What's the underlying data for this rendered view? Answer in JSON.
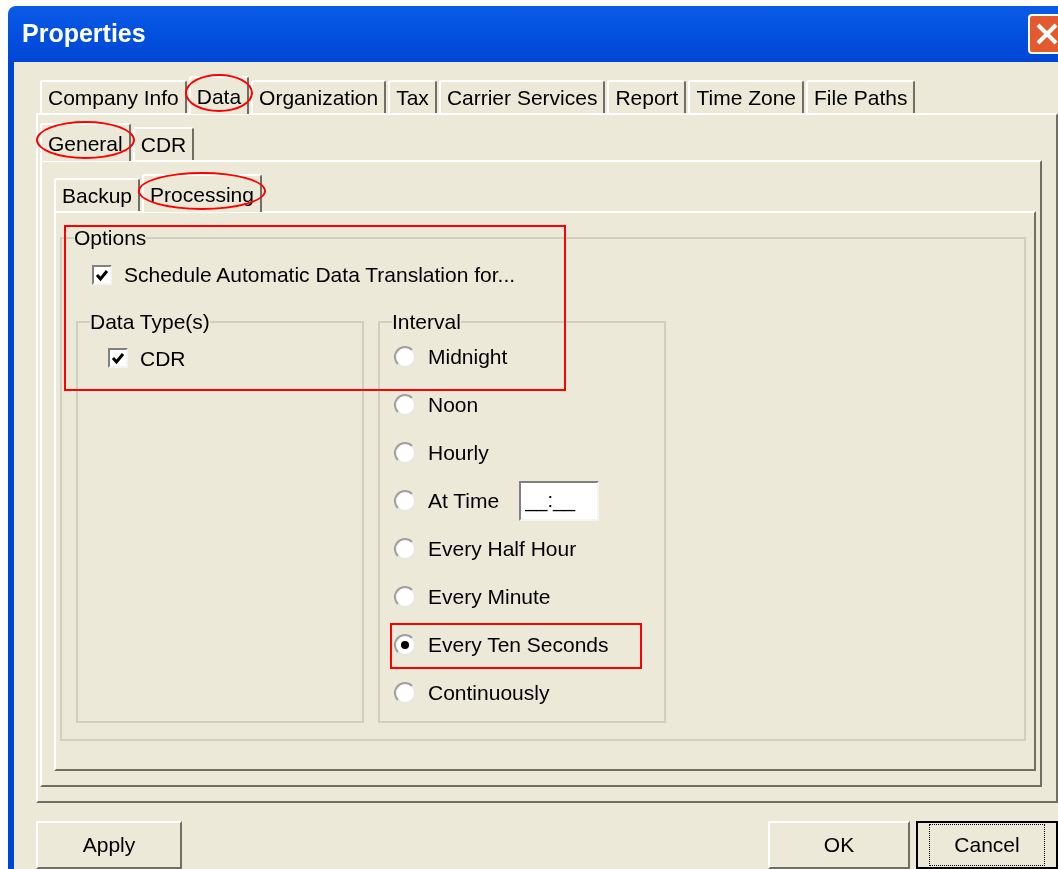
{
  "window": {
    "title": "Properties"
  },
  "tabs": [
    {
      "label": "Company Info",
      "selected": false,
      "circled": false
    },
    {
      "label": "Data",
      "selected": true,
      "circled": true
    },
    {
      "label": "Organization",
      "selected": false,
      "circled": false
    },
    {
      "label": "Tax",
      "selected": false,
      "circled": false
    },
    {
      "label": "Carrier Services",
      "selected": false,
      "circled": false
    },
    {
      "label": "Report",
      "selected": false,
      "circled": false
    },
    {
      "label": "Time Zone",
      "selected": false,
      "circled": false
    },
    {
      "label": "File Paths",
      "selected": false,
      "circled": false
    }
  ],
  "subtabs": [
    {
      "label": "General",
      "selected": true,
      "circled": true
    },
    {
      "label": "CDR",
      "selected": false,
      "circled": false
    }
  ],
  "inner_tabs": [
    {
      "label": "Backup",
      "selected": false,
      "circled": false
    },
    {
      "label": "Processing",
      "selected": true,
      "circled": true
    }
  ],
  "options": {
    "legend": "Options",
    "boxed": true,
    "schedule": {
      "label": "Schedule Automatic Data Translation for...",
      "checked": true
    },
    "data_types": {
      "legend": "Data Type(s)",
      "items": [
        {
          "label": "CDR",
          "checked": true
        }
      ]
    },
    "interval": {
      "legend": "Interval",
      "items": [
        {
          "label": "Midnight",
          "selected": false,
          "boxed": false
        },
        {
          "label": "Noon",
          "selected": false,
          "boxed": false
        },
        {
          "label": "Hourly",
          "selected": false,
          "boxed": false
        },
        {
          "label": "At Time",
          "selected": false,
          "boxed": false,
          "field_value": "__:__"
        },
        {
          "label": "Every Half Hour",
          "selected": false,
          "boxed": false
        },
        {
          "label": "Every Minute",
          "selected": false,
          "boxed": false
        },
        {
          "label": "Every Ten Seconds",
          "selected": true,
          "boxed": true
        },
        {
          "label": "Continuously",
          "selected": false,
          "boxed": false
        }
      ]
    }
  },
  "buttons": [
    {
      "label": "Apply",
      "focused": false
    },
    {
      "label": "OK",
      "focused": false
    },
    {
      "label": "Cancel",
      "focused": true
    }
  ]
}
